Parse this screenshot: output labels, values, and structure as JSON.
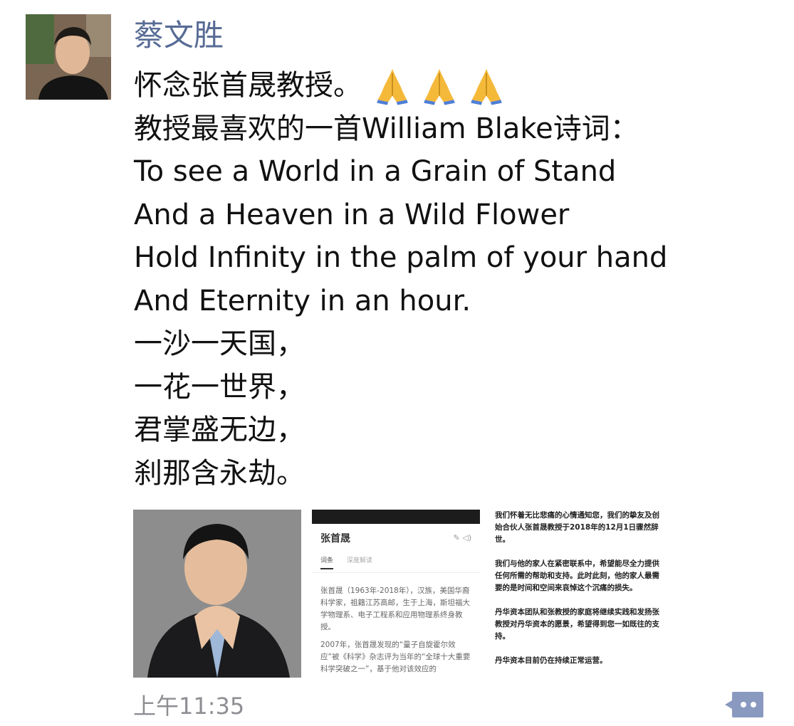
{
  "post": {
    "author": "蔡文胜",
    "lines": [
      "怀念张首晟教授。",
      "教授最喜欢的一首William Blake诗词：",
      "To see a World in a Grain of Stand",
      "And a Heaven in a Wild Flower",
      "Hold Infinity in the palm of your hand",
      "And Eternity in an hour.",
      "一沙一天国，",
      "一花一世界，",
      "君掌盛无边，",
      "刹那含永劫。"
    ],
    "emoji": [
      "folded-hands-icon",
      "folded-hands-icon",
      "folded-hands-icon"
    ],
    "time": "上午11:35"
  },
  "images": {
    "wiki": {
      "title": "张首晟",
      "icons": "✎ ◁)",
      "tab_active": "词条",
      "tab_other": "深度解读",
      "paragraph1": "张首晟（1963年-2018年），汉族，美国华裔科学家，祖籍江苏高邮，生于上海，斯坦福大学物理系、电子工程系和应用物理系终身教授。",
      "paragraph2": "2007年，张首晟发现的“量子自旋霍尔效应”被《科学》杂志评为当年的“全球十大重要科学突破之一”，基于他对该效应的"
    },
    "notice": {
      "p1": "我们怀着无比悲痛的心情通知您，我们的挚友及创始合伙人张首晟教授于2018年的12月1日骤然辞世。",
      "p2": "我们与他的家人在紧密联系中，希望能尽全力提供任何所需的帮助和支持。此时此刻，他的家人最需要的是时间和空间来哀悼这个沉痛的损失。",
      "p3": "丹华资本团队和张教授的家庭将继续实践和发扬张教授对丹华资本的愿景，希望得到您一如既往的支持。",
      "p4": "丹华资本目前仍在持续正常运营。"
    }
  },
  "colors": {
    "author_name": "#576b95",
    "timestamp": "#8e8e93",
    "comment_button": "#8a99c0"
  }
}
